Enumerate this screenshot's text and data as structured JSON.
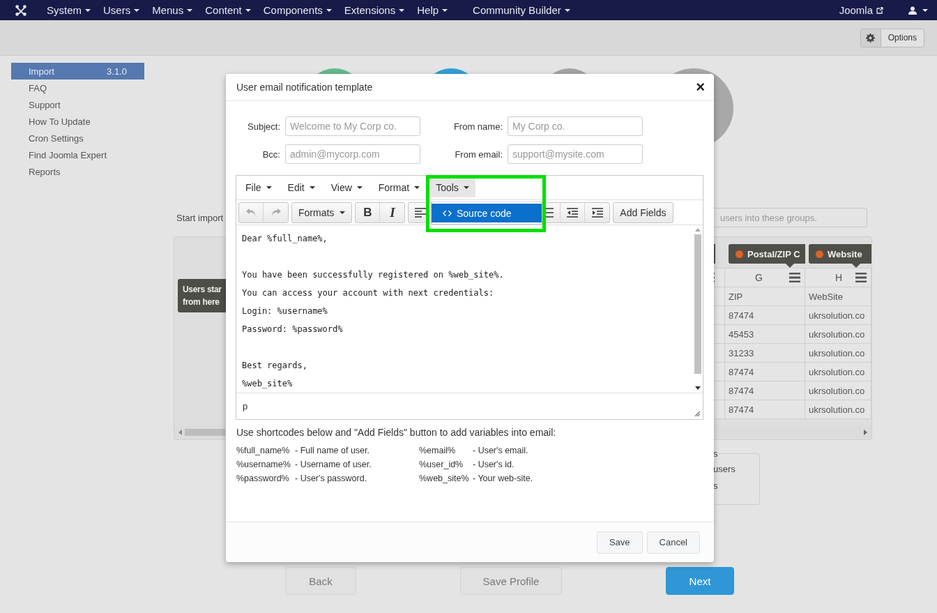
{
  "topbar": {
    "menus": [
      {
        "label": "System"
      },
      {
        "label": "Users"
      },
      {
        "label": "Menus"
      },
      {
        "label": "Content"
      },
      {
        "label": "Components"
      },
      {
        "label": "Extensions"
      },
      {
        "label": "Help"
      }
    ],
    "component_menus": [
      {
        "label": "Community Builder"
      }
    ],
    "site_link": "Joomla"
  },
  "toolbar": {
    "options_button": "Options"
  },
  "sidebar": {
    "items": [
      {
        "label": "Import",
        "badge": "3.1.0",
        "selected": true
      },
      {
        "label": "FAQ",
        "selected": false
      },
      {
        "label": "Support",
        "selected": false
      },
      {
        "label": "How To Update",
        "selected": false
      },
      {
        "label": "Cron Settings",
        "selected": false
      },
      {
        "label": "Find Joomla Expert",
        "selected": false
      },
      {
        "label": "Reports",
        "selected": false
      }
    ]
  },
  "import": {
    "start_label": "Start import",
    "groups_placeholder": "users into these groups.",
    "callout": "Users star\nfrom here",
    "columns": [
      {
        "letter": "G",
        "tag": "Postal/ZIP C",
        "field": "ZIP"
      },
      {
        "letter": "H",
        "tag": "Website",
        "field": "WebSite"
      }
    ],
    "rows": [
      [
        "87474",
        "ukrsolution.co"
      ],
      [
        "45453",
        "ukrsolution.co"
      ],
      [
        "31233",
        "ukrsolution.co"
      ],
      [
        "87474",
        "ukrsolution.co"
      ],
      [
        "87474",
        "ukrsolution.co"
      ],
      [
        "87474",
        "ukrsolution.co"
      ]
    ],
    "options_box": {
      "legend": "s",
      "lines": [
        "users",
        "s"
      ]
    },
    "buttons": [
      {
        "label": "Back",
        "kind": "default"
      },
      {
        "label": "Save Profile",
        "kind": "default"
      },
      {
        "label": "Next",
        "kind": "primary"
      }
    ]
  },
  "modal": {
    "title": "User email notification template",
    "close": "×",
    "fields": [
      {
        "label": "Subject:",
        "placeholder": "Welcome to My Corp co."
      },
      {
        "label": "From name:",
        "placeholder": "My Corp co."
      },
      {
        "label": "Bcc:",
        "placeholder": "admin@mycorp.com"
      },
      {
        "label": "From email:",
        "placeholder": "support@mysite.com"
      }
    ],
    "editor": {
      "menus": [
        {
          "label": "File",
          "selected": false
        },
        {
          "label": "Edit",
          "selected": false
        },
        {
          "label": "View",
          "selected": false
        },
        {
          "label": "Format",
          "selected": false
        },
        {
          "label": "Tools",
          "selected": true
        }
      ],
      "undo_disabled": true,
      "redo_disabled": true,
      "formats": "Formats",
      "bold": "B",
      "italic": "I",
      "add_fields": "Add Fields",
      "dropdown_item": "Source code",
      "body": [
        {
          "text": "Dear %full_name%,",
          "gap_before": false
        },
        {
          "text": "You have been successfully registered on %web_site%.",
          "gap_before": true
        },
        {
          "text": "You can access your account with next credentials:",
          "gap_before": false
        },
        {
          "text": "Login: %username%",
          "gap_before": false
        },
        {
          "text": "Password: %password%",
          "gap_before": false
        },
        {
          "text": "Best regards,",
          "gap_before": true
        },
        {
          "text": "%web_site%",
          "gap_before": false
        }
      ],
      "status_path": "p"
    },
    "hint": "Use shortcodes below and \"Add Fields\" button to add variables into email:",
    "shortcodes": [
      {
        "code": "%full_name%",
        "description": "- Full name of user."
      },
      {
        "code": "%email%",
        "description": "- User's email."
      },
      {
        "code": "%username%",
        "description": "- Username of user."
      },
      {
        "code": "%user_id%",
        "description": "- User's id."
      },
      {
        "code": "%password%",
        "description": "- User's password."
      },
      {
        "code": "%web_site%",
        "description": "- Your web-site."
      }
    ],
    "footer_buttons": [
      "Save",
      "Cancel"
    ]
  }
}
